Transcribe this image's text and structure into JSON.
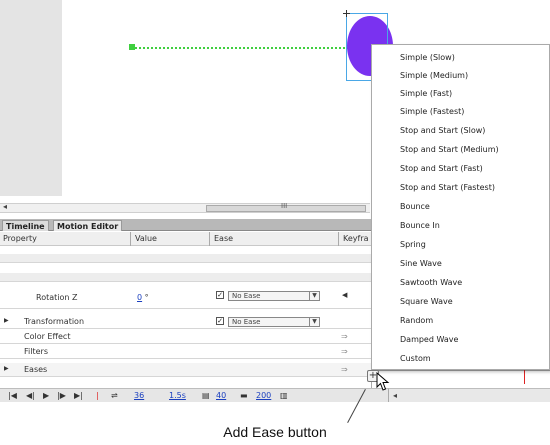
{
  "panel": {
    "tabs": [
      "Timeline",
      "Motion Editor"
    ]
  },
  "columns": {
    "property": "Property",
    "value": "Value",
    "ease": "Ease",
    "keyframe": "Keyfra"
  },
  "rows": {
    "rotation_z": {
      "label": "Rotation Z",
      "value": "0",
      "unit": "°",
      "ease": "No Ease"
    },
    "transformation": {
      "label": "Transformation",
      "ease": "No Ease"
    },
    "color_effect": {
      "label": "Color Effect"
    },
    "filters": {
      "label": "Filters"
    },
    "eases": {
      "label": "Eases"
    }
  },
  "toolbar": {
    "graph_size": "36",
    "frame_time": "1.5s",
    "expanded_graph_size": "40",
    "viewable_frames": "200"
  },
  "hscroll_grip": "III",
  "ease_menu": {
    "items": [
      "Simple (Slow)",
      "Simple (Medium)",
      "Simple (Fast)",
      "Simple (Fastest)",
      "Stop and Start (Slow)",
      "Stop and Start (Medium)",
      "Stop and Start (Fast)",
      "Stop and Start (Fastest)",
      "Bounce",
      "Bounce In",
      "Spring",
      "Sine Wave",
      "Sawtooth Wave",
      "Square Wave",
      "Random",
      "Damped Wave",
      "Custom"
    ]
  },
  "caption": "Add Ease button",
  "colors": {
    "circle": "#7a32f0",
    "motion_path": "#3fcf3f",
    "selection": "#4aa7e6"
  }
}
